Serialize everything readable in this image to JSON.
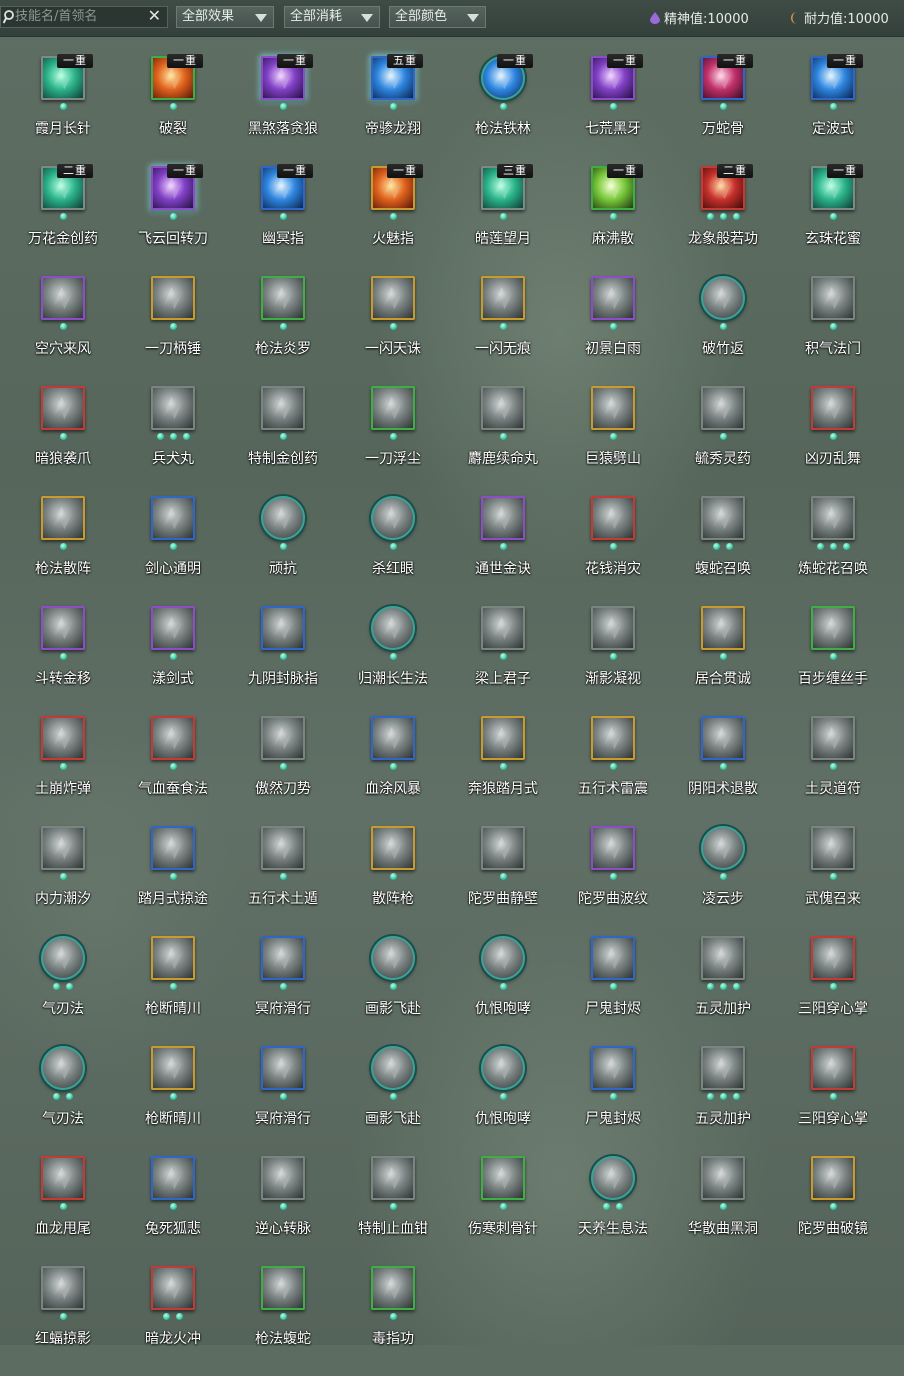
{
  "toolbar": {
    "search_placeholder": "技能名/首领名",
    "clear_glyph": "✕",
    "effect_filter": "全部效果",
    "cost_filter": "全部消耗",
    "color_filter": "全部颜色",
    "spirit_label": "精神值:",
    "spirit_value": "10000",
    "stamina_label": "耐力值:",
    "stamina_value": "10000"
  },
  "skills": [
    {
      "name": "霞月长针",
      "tier": "一重",
      "dots": 1,
      "border": "teal",
      "tint": "teal",
      "glow": false
    },
    {
      "name": "破裂",
      "tier": "一重",
      "dots": 1,
      "border": "green",
      "tint": "fire",
      "glow": false
    },
    {
      "name": "黑煞落贪狼",
      "tier": "一重",
      "dots": 1,
      "border": "purple",
      "tint": "violet",
      "glow": true
    },
    {
      "name": "帝骖龙翔",
      "tier": "五重",
      "dots": 1,
      "border": "blue",
      "tint": "azure",
      "glow": true
    },
    {
      "name": "枪法铁林",
      "tier": "一重",
      "dots": 1,
      "border": "round",
      "tint": "azure",
      "glow": false
    },
    {
      "name": "七荒黑牙",
      "tier": "一重",
      "dots": 1,
      "border": "purple",
      "tint": "violet",
      "glow": false
    },
    {
      "name": "万蛇骨",
      "tier": "一重",
      "dots": 1,
      "border": "blue",
      "tint": "rose",
      "glow": false
    },
    {
      "name": "定波式",
      "tier": "一重",
      "dots": 1,
      "border": "blue",
      "tint": "azure",
      "glow": false
    },
    {
      "name": "万花金创药",
      "tier": "二重",
      "dots": 1,
      "border": "teal",
      "tint": "teal",
      "glow": false
    },
    {
      "name": "飞云回转刀",
      "tier": "一重",
      "dots": 1,
      "border": "purple",
      "tint": "violet",
      "glow": true
    },
    {
      "name": "幽冥指",
      "tier": "一重",
      "dots": 1,
      "border": "blue",
      "tint": "azure",
      "glow": false
    },
    {
      "name": "火魅指",
      "tier": "一重",
      "dots": 1,
      "border": "gold",
      "tint": "fire",
      "glow": false
    },
    {
      "name": "皓莲望月",
      "tier": "三重",
      "dots": 1,
      "border": "teal",
      "tint": "teal",
      "glow": false
    },
    {
      "name": "麻沸散",
      "tier": "一重",
      "dots": 1,
      "border": "green",
      "tint": "lime",
      "glow": false
    },
    {
      "name": "龙象般若功",
      "tier": "二重",
      "dots": 3,
      "border": "red",
      "tint": "crim",
      "glow": false
    },
    {
      "name": "玄珠花蜜",
      "tier": "一重",
      "dots": 1,
      "border": "teal",
      "tint": "teal",
      "glow": false
    },
    {
      "name": "空穴来风",
      "tier": "",
      "dots": 1,
      "border": "purple",
      "tint": "",
      "glow": false
    },
    {
      "name": "一刀柄锤",
      "tier": "",
      "dots": 1,
      "border": "gold",
      "tint": "",
      "glow": false
    },
    {
      "name": "枪法炎罗",
      "tier": "",
      "dots": 1,
      "border": "green",
      "tint": "",
      "glow": false
    },
    {
      "name": "一闪天诛",
      "tier": "",
      "dots": 1,
      "border": "gold",
      "tint": "",
      "glow": false
    },
    {
      "name": "一闪无痕",
      "tier": "",
      "dots": 1,
      "border": "gold",
      "tint": "",
      "glow": false
    },
    {
      "name": "初景白雨",
      "tier": "",
      "dots": 1,
      "border": "purple",
      "tint": "",
      "glow": false
    },
    {
      "name": "破竹返",
      "tier": "",
      "dots": 1,
      "border": "round",
      "tint": "",
      "glow": false
    },
    {
      "name": "积气法门",
      "tier": "",
      "dots": 1,
      "border": "gray",
      "tint": "",
      "glow": false
    },
    {
      "name": "暗狼袭爪",
      "tier": "",
      "dots": 1,
      "border": "red",
      "tint": "",
      "glow": false
    },
    {
      "name": "兵犬丸",
      "tier": "",
      "dots": 3,
      "border": "gray",
      "tint": "",
      "glow": false
    },
    {
      "name": "特制金创药",
      "tier": "",
      "dots": 1,
      "border": "gray",
      "tint": "",
      "glow": false
    },
    {
      "name": "一刀浮尘",
      "tier": "",
      "dots": 1,
      "border": "green",
      "tint": "",
      "glow": false
    },
    {
      "name": "麝鹿续命丸",
      "tier": "",
      "dots": 1,
      "border": "gray",
      "tint": "",
      "glow": false
    },
    {
      "name": "巨猿劈山",
      "tier": "",
      "dots": 1,
      "border": "gold",
      "tint": "",
      "glow": false
    },
    {
      "name": "毓秀灵药",
      "tier": "",
      "dots": 1,
      "border": "gray",
      "tint": "",
      "glow": false
    },
    {
      "name": "凶刃乱舞",
      "tier": "",
      "dots": 1,
      "border": "red",
      "tint": "",
      "glow": false
    },
    {
      "name": "枪法散阵",
      "tier": "",
      "dots": 1,
      "border": "gold",
      "tint": "",
      "glow": false
    },
    {
      "name": "剑心通明",
      "tier": "",
      "dots": 1,
      "border": "blue",
      "tint": "",
      "glow": false
    },
    {
      "name": "顽抗",
      "tier": "",
      "dots": 1,
      "border": "round",
      "tint": "",
      "glow": false
    },
    {
      "name": "杀红眼",
      "tier": "",
      "dots": 1,
      "border": "round",
      "tint": "",
      "glow": false
    },
    {
      "name": "通世金诀",
      "tier": "",
      "dots": 1,
      "border": "purple",
      "tint": "",
      "glow": false
    },
    {
      "name": "花钱消灾",
      "tier": "",
      "dots": 1,
      "border": "red",
      "tint": "",
      "glow": false
    },
    {
      "name": "蝮蛇召唤",
      "tier": "",
      "dots": 2,
      "border": "gray",
      "tint": "",
      "glow": false
    },
    {
      "name": "炼蛇花召唤",
      "tier": "",
      "dots": 3,
      "border": "gray",
      "tint": "",
      "glow": false
    },
    {
      "name": "斗转金移",
      "tier": "",
      "dots": 1,
      "border": "purple",
      "tint": "",
      "glow": false
    },
    {
      "name": "漾剑式",
      "tier": "",
      "dots": 1,
      "border": "purple",
      "tint": "",
      "glow": false
    },
    {
      "name": "九阴封脉指",
      "tier": "",
      "dots": 1,
      "border": "blue",
      "tint": "",
      "glow": false
    },
    {
      "name": "归潮长生法",
      "tier": "",
      "dots": 1,
      "border": "round",
      "tint": "",
      "glow": false
    },
    {
      "name": "梁上君子",
      "tier": "",
      "dots": 1,
      "border": "gray",
      "tint": "",
      "glow": false
    },
    {
      "name": "渐影凝视",
      "tier": "",
      "dots": 1,
      "border": "gray",
      "tint": "",
      "glow": false
    },
    {
      "name": "居合贯诚",
      "tier": "",
      "dots": 1,
      "border": "gold",
      "tint": "",
      "glow": false
    },
    {
      "name": "百步缠丝手",
      "tier": "",
      "dots": 1,
      "border": "green",
      "tint": "",
      "glow": false
    },
    {
      "name": "土崩炸弹",
      "tier": "",
      "dots": 1,
      "border": "red",
      "tint": "",
      "glow": false
    },
    {
      "name": "气血蚕食法",
      "tier": "",
      "dots": 1,
      "border": "red",
      "tint": "",
      "glow": false
    },
    {
      "name": "傲然刀势",
      "tier": "",
      "dots": 1,
      "border": "gray",
      "tint": "",
      "glow": false
    },
    {
      "name": "血涂风暴",
      "tier": "",
      "dots": 1,
      "border": "blue",
      "tint": "",
      "glow": false
    },
    {
      "name": "奔狼踏月式",
      "tier": "",
      "dots": 1,
      "border": "gold",
      "tint": "",
      "glow": false
    },
    {
      "name": "五行术雷震",
      "tier": "",
      "dots": 1,
      "border": "gold",
      "tint": "",
      "glow": false
    },
    {
      "name": "阴阳术退散",
      "tier": "",
      "dots": 1,
      "border": "blue",
      "tint": "",
      "glow": false
    },
    {
      "name": "土灵道符",
      "tier": "",
      "dots": 1,
      "border": "gray",
      "tint": "",
      "glow": false
    },
    {
      "name": "内力潮汐",
      "tier": "",
      "dots": 1,
      "border": "gray",
      "tint": "",
      "glow": false
    },
    {
      "name": "踏月式掠途",
      "tier": "",
      "dots": 1,
      "border": "blue",
      "tint": "",
      "glow": false
    },
    {
      "name": "五行术土遁",
      "tier": "",
      "dots": 1,
      "border": "gray",
      "tint": "",
      "glow": false
    },
    {
      "name": "散阵枪",
      "tier": "",
      "dots": 1,
      "border": "gold",
      "tint": "",
      "glow": false
    },
    {
      "name": "陀罗曲静壁",
      "tier": "",
      "dots": 1,
      "border": "gray",
      "tint": "",
      "glow": false
    },
    {
      "name": "陀罗曲波纹",
      "tier": "",
      "dots": 1,
      "border": "purple",
      "tint": "",
      "glow": false
    },
    {
      "name": "凌云步",
      "tier": "",
      "dots": 1,
      "border": "round",
      "tint": "",
      "glow": false
    },
    {
      "name": "武傀召来",
      "tier": "",
      "dots": 1,
      "border": "gray",
      "tint": "",
      "glow": false
    },
    {
      "name": "气刃法",
      "tier": "",
      "dots": 2,
      "border": "round",
      "tint": "",
      "glow": false
    },
    {
      "name": "枪断晴川",
      "tier": "",
      "dots": 1,
      "border": "gold",
      "tint": "",
      "glow": false
    },
    {
      "name": "冥府滑行",
      "tier": "",
      "dots": 1,
      "border": "blue",
      "tint": "",
      "glow": false
    },
    {
      "name": "画影飞赴",
      "tier": "",
      "dots": 1,
      "border": "round",
      "tint": "",
      "glow": false
    },
    {
      "name": "仇恨咆哮",
      "tier": "",
      "dots": 1,
      "border": "round",
      "tint": "",
      "glow": false
    },
    {
      "name": "尸鬼封烬",
      "tier": "",
      "dots": 1,
      "border": "blue",
      "tint": "",
      "glow": false
    },
    {
      "name": "五灵加护",
      "tier": "",
      "dots": 3,
      "border": "gray",
      "tint": "",
      "glow": false
    },
    {
      "name": "三阳穿心掌",
      "tier": "",
      "dots": 1,
      "border": "red",
      "tint": "",
      "glow": false
    },
    {
      "name": "气刃法",
      "tier": "",
      "dots": 2,
      "border": "round",
      "tint": "",
      "glow": false
    },
    {
      "name": "枪断晴川",
      "tier": "",
      "dots": 1,
      "border": "gold",
      "tint": "",
      "glow": false
    },
    {
      "name": "冥府滑行",
      "tier": "",
      "dots": 1,
      "border": "blue",
      "tint": "",
      "glow": false
    },
    {
      "name": "画影飞赴",
      "tier": "",
      "dots": 1,
      "border": "round",
      "tint": "",
      "glow": false
    },
    {
      "name": "仇恨咆哮",
      "tier": "",
      "dots": 1,
      "border": "round",
      "tint": "",
      "glow": false
    },
    {
      "name": "尸鬼封烬",
      "tier": "",
      "dots": 1,
      "border": "blue",
      "tint": "",
      "glow": false
    },
    {
      "name": "五灵加护",
      "tier": "",
      "dots": 3,
      "border": "gray",
      "tint": "",
      "glow": false
    },
    {
      "name": "三阳穿心掌",
      "tier": "",
      "dots": 1,
      "border": "red",
      "tint": "",
      "glow": false
    },
    {
      "name": "血龙甩尾",
      "tier": "",
      "dots": 1,
      "border": "red",
      "tint": "",
      "glow": false
    },
    {
      "name": "兔死狐悲",
      "tier": "",
      "dots": 1,
      "border": "blue",
      "tint": "",
      "glow": false
    },
    {
      "name": "逆心转脉",
      "tier": "",
      "dots": 1,
      "border": "gray",
      "tint": "",
      "glow": false
    },
    {
      "name": "特制止血钳",
      "tier": "",
      "dots": 1,
      "border": "gray",
      "tint": "",
      "glow": false
    },
    {
      "name": "伤寒刺骨针",
      "tier": "",
      "dots": 1,
      "border": "green",
      "tint": "",
      "glow": false
    },
    {
      "name": "天养生息法",
      "tier": "",
      "dots": 2,
      "border": "round",
      "tint": "",
      "glow": false
    },
    {
      "name": "华散曲黑洞",
      "tier": "",
      "dots": 1,
      "border": "gray",
      "tint": "",
      "glow": false
    },
    {
      "name": "陀罗曲破镜",
      "tier": "",
      "dots": 1,
      "border": "gold",
      "tint": "",
      "glow": false
    },
    {
      "name": "红蝠掠影",
      "tier": "",
      "dots": 1,
      "border": "gray",
      "tint": "",
      "glow": false
    },
    {
      "name": "暗龙火冲",
      "tier": "",
      "dots": 2,
      "border": "red",
      "tint": "",
      "glow": false
    },
    {
      "name": "枪法蝮蛇",
      "tier": "",
      "dots": 1,
      "border": "green",
      "tint": "",
      "glow": false
    },
    {
      "name": "毒指功",
      "tier": "",
      "dots": 1,
      "border": "green",
      "tint": "",
      "glow": false
    }
  ]
}
